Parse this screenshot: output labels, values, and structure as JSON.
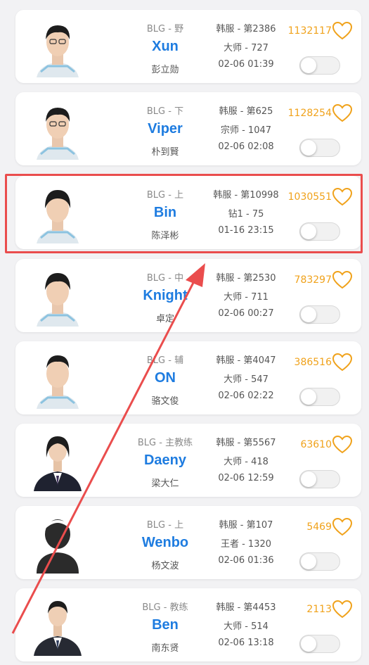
{
  "players": [
    {
      "team": "BLG - 野",
      "ign": "Xun",
      "realname": "彭立勋",
      "server": "韩服 - 第2386",
      "tier": "大师 - 727",
      "time": "02-06 01:39",
      "likes": "1132117",
      "avatar": "player-photo"
    },
    {
      "team": "BLG - 下",
      "ign": "Viper",
      "realname": "朴到賢",
      "server": "韩服 - 第625",
      "tier": "宗师 - 1047",
      "time": "02-06 02:08",
      "likes": "1128254",
      "avatar": "player-photo"
    },
    {
      "team": "BLG - 上",
      "ign": "Bin",
      "realname": "陈泽彬",
      "server": "韩服 - 第10998",
      "tier": "钻1 - 75",
      "time": "01-16 23:15",
      "likes": "1030551",
      "avatar": "player-photo"
    },
    {
      "team": "BLG - 中",
      "ign": "Knight",
      "realname": "卓定",
      "server": "韩服 - 第2530",
      "tier": "大师 - 711",
      "time": "02-06 00:27",
      "likes": "783297",
      "avatar": "player-photo"
    },
    {
      "team": "BLG - 辅",
      "ign": "ON",
      "realname": "骆文俊",
      "server": "韩服 - 第4047",
      "tier": "大师 - 547",
      "time": "02-06 02:22",
      "likes": "386516",
      "avatar": "player-photo"
    },
    {
      "team": "BLG - 主教练",
      "ign": "Daeny",
      "realname": "梁大仁",
      "server": "韩服 - 第5567",
      "tier": "大师 - 418",
      "time": "02-06 12:59",
      "likes": "63610",
      "avatar": "coach-photo"
    },
    {
      "team": "BLG - 上",
      "ign": "Wenbo",
      "realname": "杨文波",
      "server": "韩服 - 第107",
      "tier": "王者 - 1320",
      "time": "02-06 01:36",
      "likes": "5469",
      "avatar": "default-silhouette"
    },
    {
      "team": "BLG - 教练",
      "ign": "Ben",
      "realname": "南东贤",
      "server": "韩服 - 第4453",
      "tier": "大师 - 514",
      "time": "02-06 13:18",
      "likes": "2113",
      "avatar": "coach-photo"
    }
  ],
  "colors": {
    "ign": "#1e7ce0",
    "likes": "#f0a21b",
    "highlight": "#ea4d4d",
    "arrow": "#ea4d4d"
  },
  "icons": {
    "like": "heart-outline-icon",
    "subscribe": "toggle-switch"
  },
  "highlighted_index": 2
}
